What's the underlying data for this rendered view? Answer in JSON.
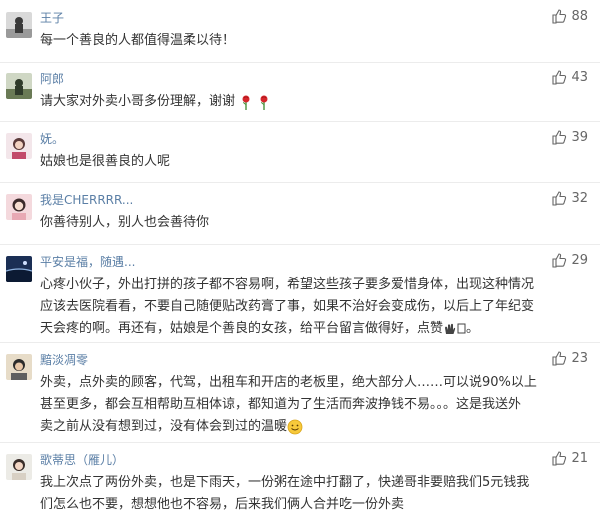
{
  "comments": [
    {
      "username": "王子",
      "likes": "88",
      "lines": [
        "每一个善良的人都值得温柔以待！"
      ]
    },
    {
      "username": "阿郎",
      "likes": "43",
      "lines": [
        "请大家对外卖小哥多份理解，谢谢"
      ]
    },
    {
      "username": "妩。",
      "likes": "39",
      "lines": [
        "姑娘也是很善良的人呢"
      ]
    },
    {
      "username": "我是CHERRRR...",
      "likes": "32",
      "lines": [
        "你善待别人，别人也会善待你"
      ]
    },
    {
      "username": "平安是福，随遇...",
      "likes": "29",
      "lines": [
        "心疼小伙子，外出打拼的孩子都不容易啊，希望这些孩子要多爱惜身体，出现这种情况",
        "应该去医院看看，不要自己随便贴改药膏了事，如果不治好会变成伤，以后上了年纪变",
        "天会疼的啊。再还有，姑娘是个善良的女孩，给平台留言做得好，点赞"
      ]
    },
    {
      "username": "黯淡凋零",
      "likes": "23",
      "lines": [
        "外卖，点外卖的顾客，代驾，出租车和开店的老板里，绝大部分人……可以说90%以上",
        "甚至更多，都会互相帮助互相体谅，都知道为了生活而奔波挣钱不易。。。这是我送外",
        "卖之前从没有想到过，没有体会到过的温暖"
      ]
    },
    {
      "username": "歌蒂思（雁儿）",
      "likes": "21",
      "lines": [
        "我上次点了两份外卖，也是下雨天，一份粥在途中打翻了，快递哥非要赔我们5元钱我",
        "们怎么也不要，想想他也不容易，后来我们俩人合并吃一份外卖"
      ]
    }
  ],
  "colors": {
    "username": "#5b7fa6",
    "text": "#333333",
    "likes": "#666666",
    "divider": "#ececec"
  },
  "icons": {
    "like": "thumbs-up-icon",
    "rose": "rose-emoji-icon",
    "clap": "clap-emoji-icon",
    "smile": "smile-emoji-icon"
  }
}
